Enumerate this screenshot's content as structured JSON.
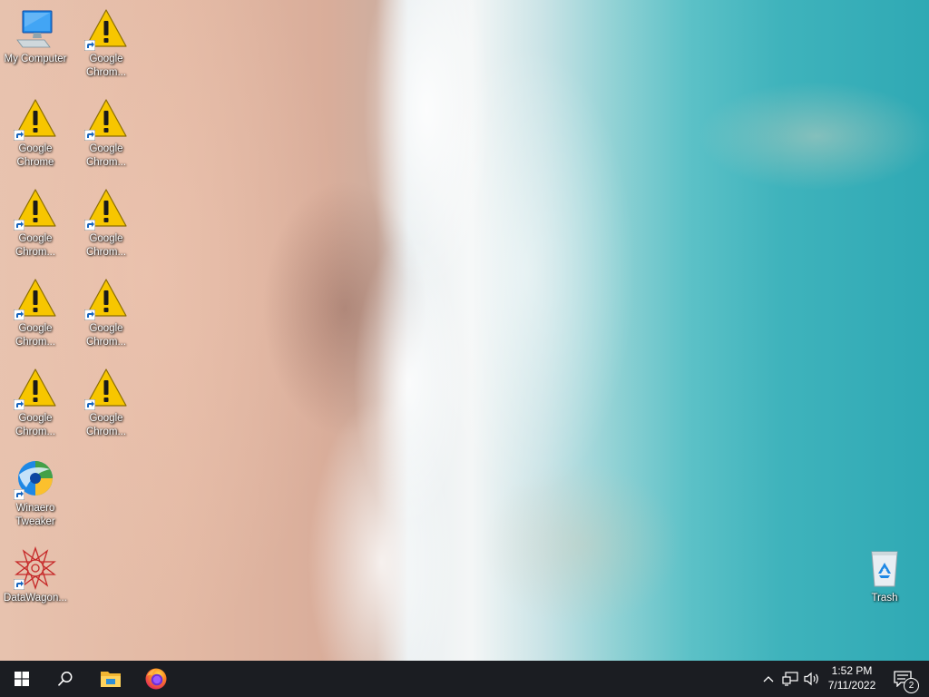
{
  "desktop": {
    "icons": [
      {
        "label": "My Computer",
        "icon": "computer-icon"
      },
      {
        "label": "Google\nChrom...",
        "icon": "warning-icon"
      },
      {
        "label": "Google\nChrome",
        "icon": "warning-icon"
      },
      {
        "label": "Google\nChrom...",
        "icon": "warning-icon"
      },
      {
        "label": "Google\nChrom...",
        "icon": "warning-icon"
      },
      {
        "label": "Google\nChrom...",
        "icon": "warning-icon"
      },
      {
        "label": "Google\nChrom...",
        "icon": "warning-icon"
      },
      {
        "label": "Google\nChrom...",
        "icon": "warning-icon"
      },
      {
        "label": "Google\nChrom...",
        "icon": "warning-icon"
      },
      {
        "label": "Google\nChrom...",
        "icon": "warning-icon"
      },
      {
        "label": "Winaero\nTweaker",
        "icon": "winaero-tweaker-icon"
      },
      {
        "label": "DataWagon...",
        "icon": "datawagon-icon"
      },
      {
        "label": "Trash",
        "icon": "recycle-bin-icon"
      }
    ]
  },
  "taskbar": {
    "start": "windows-logo-icon",
    "search": "search-icon",
    "pinned": [
      "file-explorer-icon",
      "firefox-icon"
    ],
    "tray": {
      "chevron": "chevron-up-icon",
      "network": "network-icon",
      "volume": "volume-icon",
      "time": "1:52 PM",
      "date": "7/11/2022",
      "notification_count": "2"
    }
  },
  "colors": {
    "taskbar_bg": "#1b1d22",
    "warning_yellow": "#f5c518",
    "icon_label_text": "#ffffff"
  }
}
